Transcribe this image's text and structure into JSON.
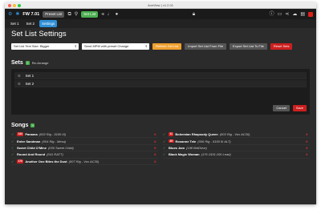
{
  "window": {
    "title": "AxeView | v1.2.01"
  },
  "toolbar": {
    "fw_label": "FW 7.01",
    "preset_label": "Preset List",
    "setlist_label": "Set List"
  },
  "tabs": [
    {
      "label": "Set 1",
      "active": false
    },
    {
      "label": "Set 2",
      "active": false
    },
    {
      "label": "Settings",
      "active": true
    }
  ],
  "page": {
    "title": "Set List Settings"
  },
  "settings": {
    "text_size_value": "Set List Text Size: Bigger",
    "mode_value": "Send MPM with preset Change",
    "buttons": {
      "refetch": "Refetch Set List",
      "import": "Import Set List From File",
      "export": "Export Set List To File",
      "reset": "Reset Sets"
    }
  },
  "sets": {
    "title": "Sets",
    "add": "+",
    "rearrange": "Re-Arrange",
    "items": [
      "Set 1",
      "Set 2"
    ],
    "cancel": "Cancel",
    "save": "Save"
  },
  "songs": {
    "title": "Songs",
    "add": "+",
    "left": [
      {
        "num": "144",
        "name": "Panama",
        "meta": "(002 Rig - 5150 III)"
      },
      {
        "num": "",
        "name": "Enter Sandman",
        "meta": "(004 Rig - Mesa)"
      },
      {
        "num": "",
        "name": "Sweet Child O'Mine",
        "meta": "(030 Sweet Child)"
      },
      {
        "num": "",
        "name": "Round And Round",
        "meta": "(041 RATT)"
      },
      {
        "num": "170",
        "name": "Another One Bites the Dust",
        "meta": "(007 Rig - Vox AC30)"
      }
    ],
    "right": [
      {
        "num": "11",
        "name": "Bohemian Rhapsody Queen",
        "meta": "(003 Rig - Vox AC30)"
      },
      {
        "num": "25",
        "name": "Roxanne Tele",
        "meta": "(006 Rig - 5150 III ALT)"
      },
      {
        "num": "",
        "name": "Blues Jam",
        "meta": "(198 BritDrive)"
      },
      {
        "num": "",
        "name": "Black Magic Woman",
        "meta": "(176 ODS-100 Lead)"
      }
    ]
  },
  "colors": {
    "accent": "#2f8fd6",
    "green": "#4caf50",
    "orange": "#f0a030",
    "red": "#cc1f1f"
  }
}
